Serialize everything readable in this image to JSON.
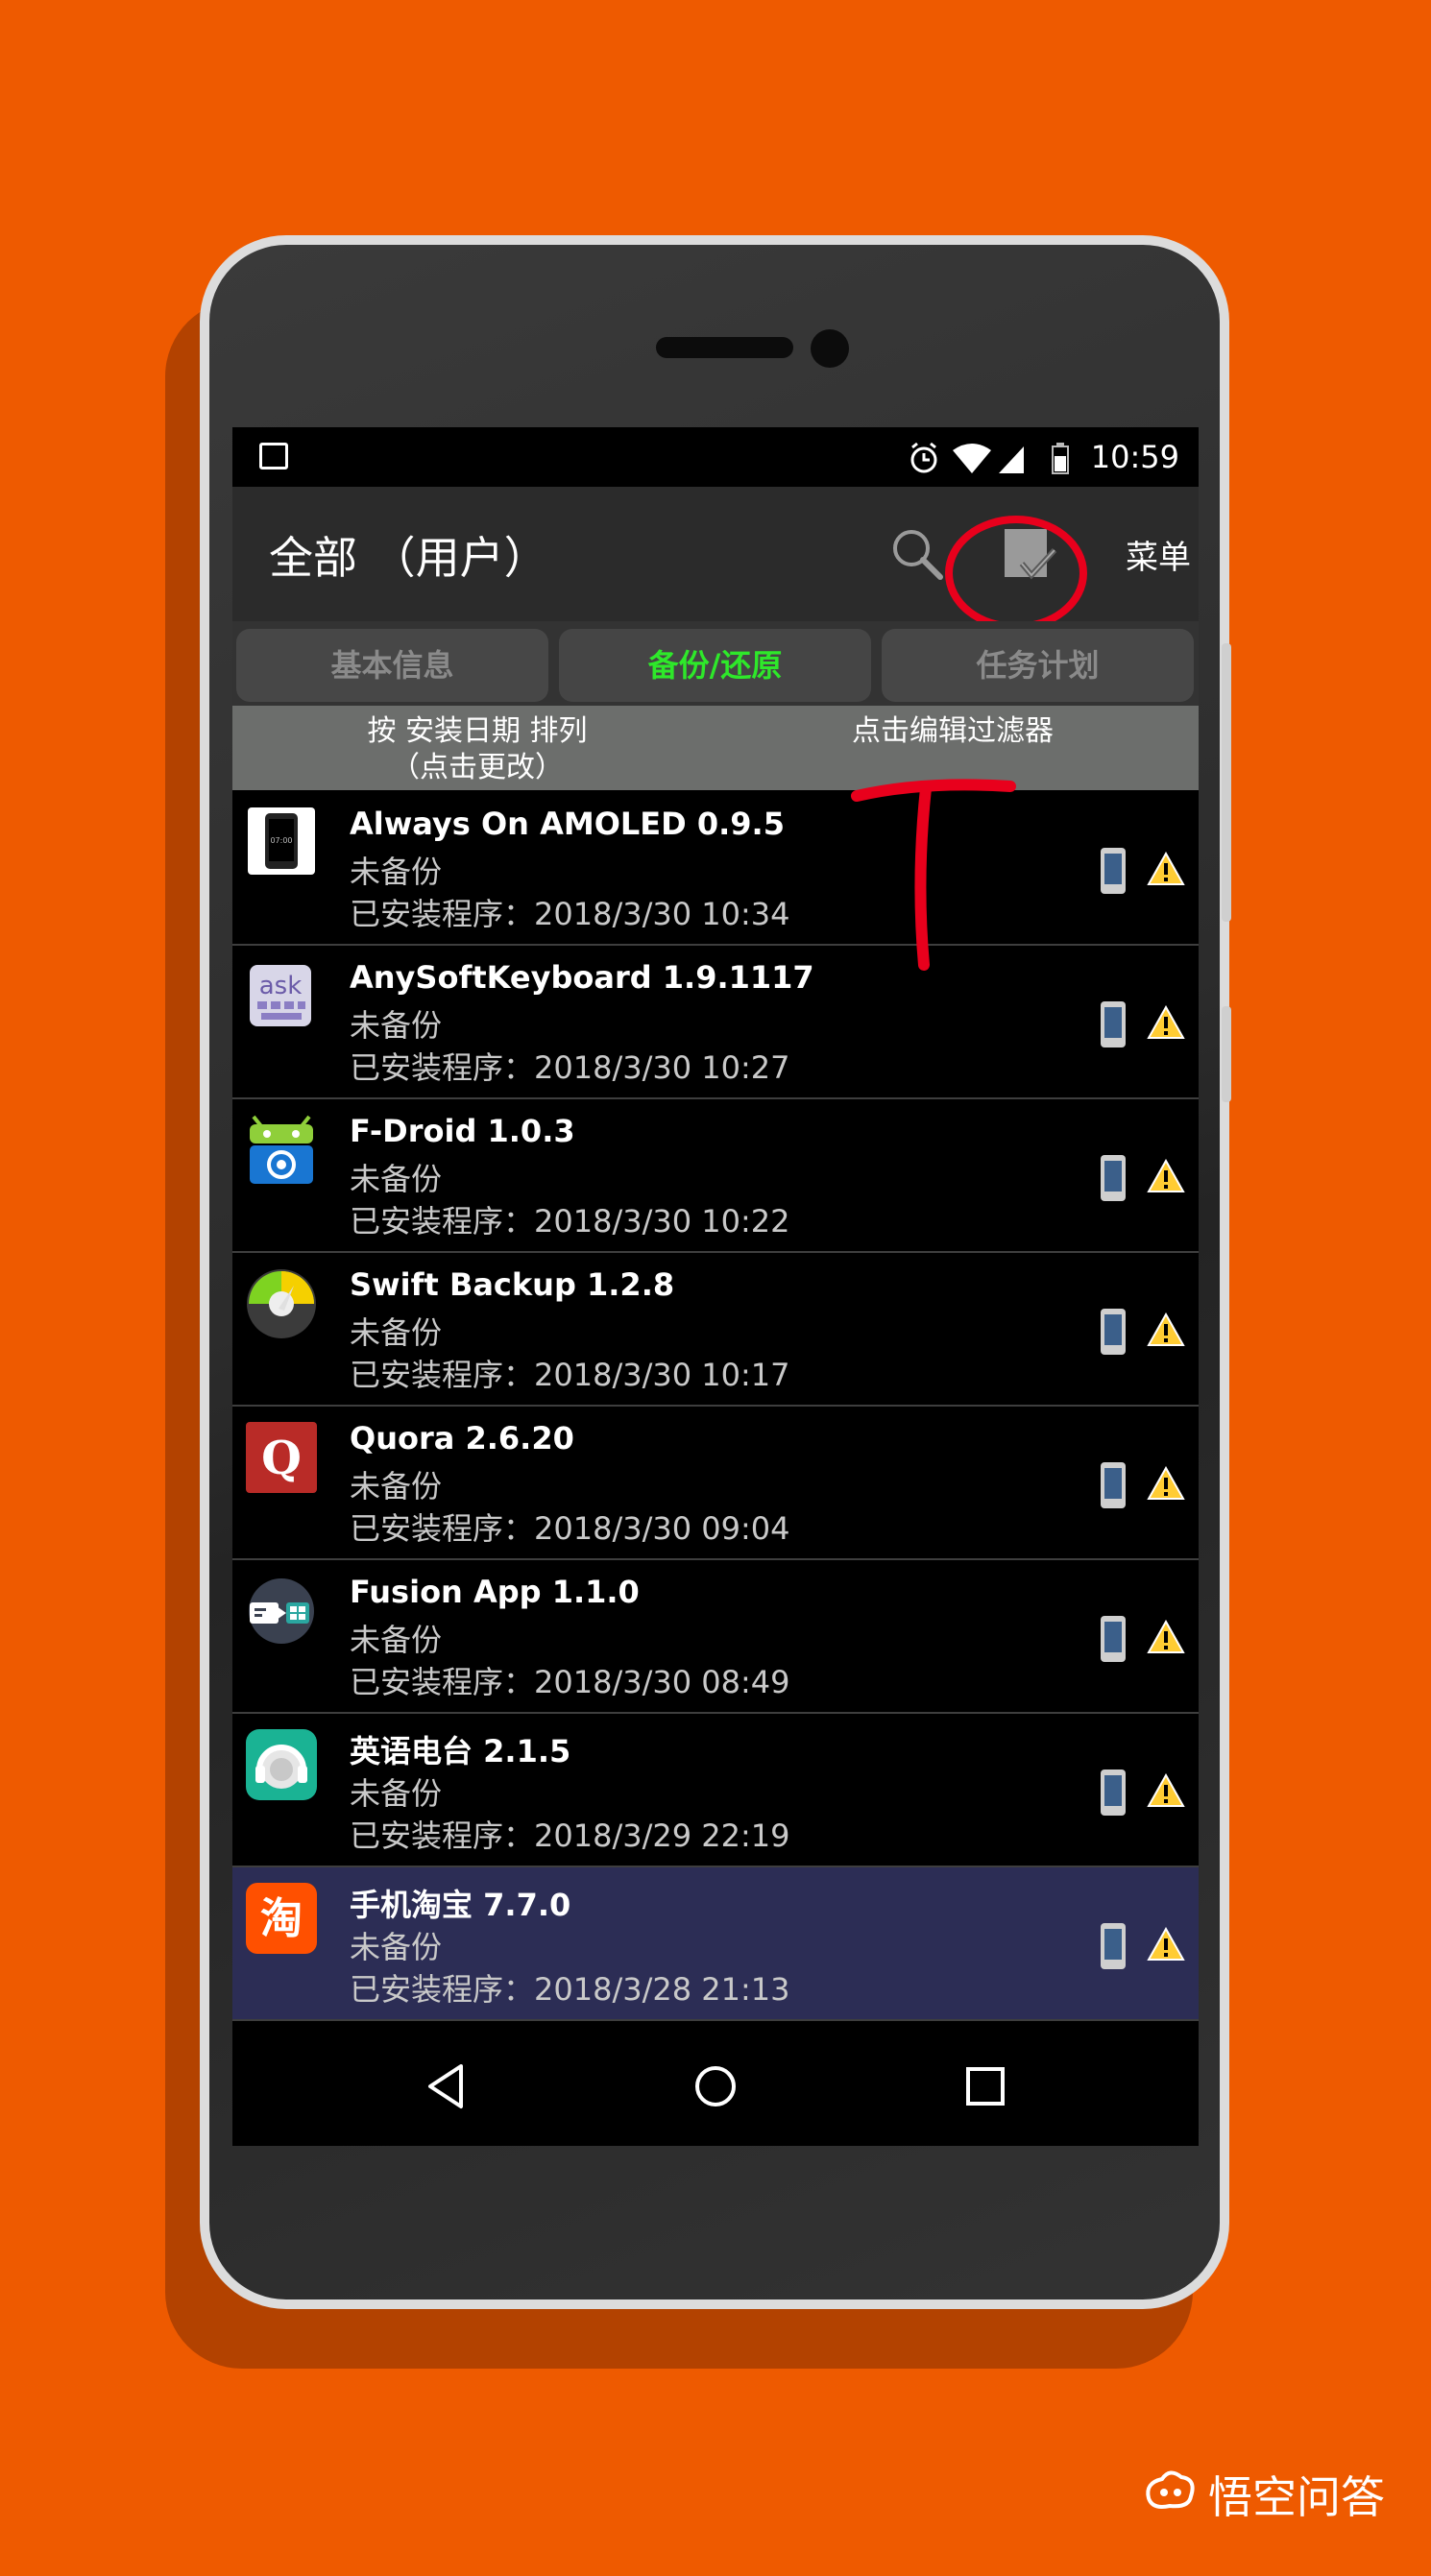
{
  "status_bar": {
    "time": "10:59"
  },
  "action_bar": {
    "title": "全部 （用户）",
    "menu_label": "菜单"
  },
  "tabs": [
    {
      "label": "基本信息",
      "active": false
    },
    {
      "label": "备份/还原",
      "active": true
    },
    {
      "label": "任务计划",
      "active": false
    }
  ],
  "sort_bar": {
    "sort_line1": "按 安装日期 排列",
    "sort_line2": "（点击更改）",
    "filter_hint": "点击编辑过滤器"
  },
  "apps": [
    {
      "name": "Always On AMOLED 0.9.5",
      "status": "未备份",
      "installed": "已安装程序：2018/3/30 10:34",
      "icon": "amoled-icon"
    },
    {
      "name": "AnySoftKeyboard 1.9.1117",
      "status": "未备份",
      "installed": "已安装程序：2018/3/30 10:27",
      "icon": "ask-keyboard-icon"
    },
    {
      "name": "F-Droid 1.0.3",
      "status": "未备份",
      "installed": "已安装程序：2018/3/30 10:22",
      "icon": "fdroid-icon"
    },
    {
      "name": "Swift Backup 1.2.8",
      "status": "未备份",
      "installed": "已安装程序：2018/3/30 10:17",
      "icon": "swift-backup-icon"
    },
    {
      "name": "Quora 2.6.20",
      "status": "未备份",
      "installed": "已安装程序：2018/3/30 09:04",
      "icon": "quora-icon"
    },
    {
      "name": "Fusion App 1.1.0",
      "status": "未备份",
      "installed": "已安装程序：2018/3/30 08:49",
      "icon": "fusion-app-icon"
    },
    {
      "name": "英语电台 2.1.5",
      "status": "未备份",
      "installed": "已安装程序：2018/3/29 22:19",
      "icon": "english-radio-icon"
    },
    {
      "name": "手机淘宝 7.7.0",
      "status": "未备份",
      "installed": "已安装程序：2018/3/28 21:13",
      "icon": "taobao-icon"
    }
  ],
  "watermark": {
    "text": "悟空问答"
  },
  "colors": {
    "background": "#ee5a00",
    "active_tab": "#2ee82a",
    "annotation": "#e8001c",
    "selected_row": "#2c2d55"
  }
}
